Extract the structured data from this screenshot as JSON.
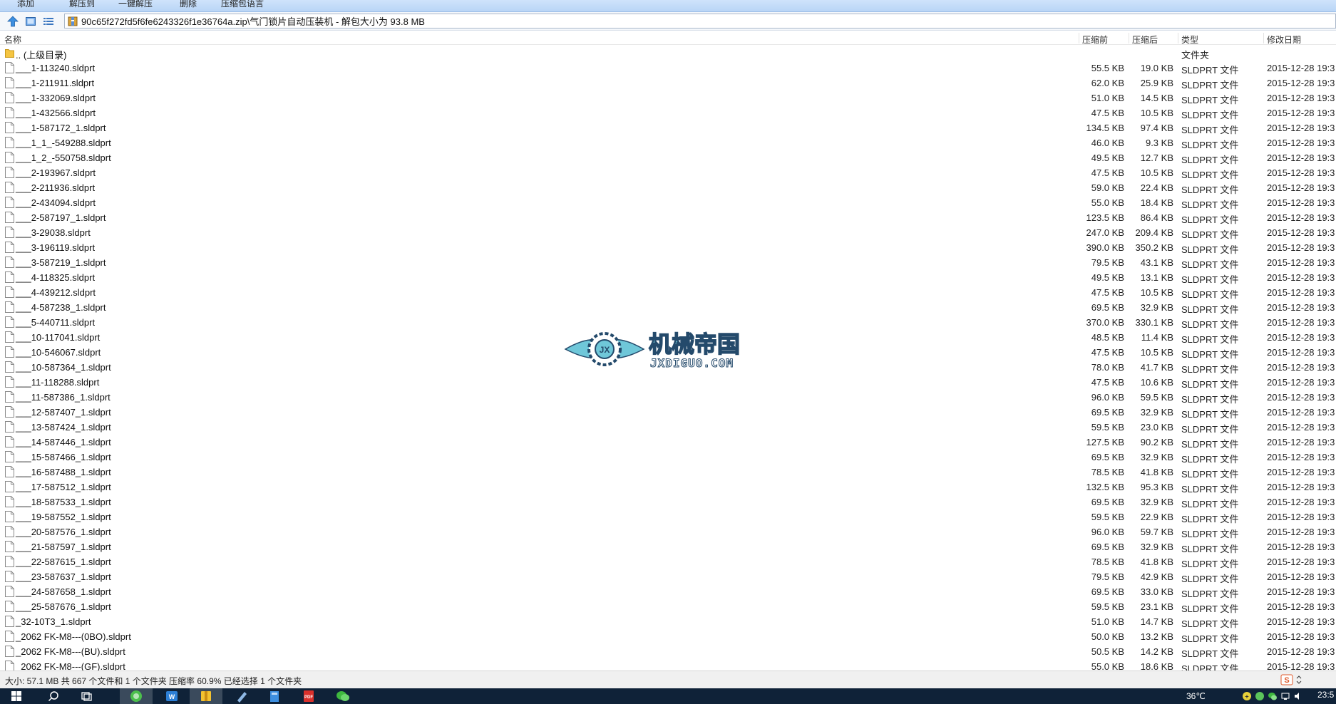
{
  "toolbar": {
    "buttons": [
      "添加",
      "解压到",
      "一键解压",
      "删除",
      "压缩包语言"
    ]
  },
  "address": {
    "path": "90c65f272fd5f6fe6243326f1e36764a.zip\\气门锁片自动压装机 - 解包大小为 93.8 MB"
  },
  "columns": {
    "name": "名称",
    "compressed": "压缩前",
    "packed": "压缩后",
    "type": "类型",
    "modified": "修改日期"
  },
  "parent_dir": {
    "name": ".. (上级目录)",
    "type": "文件夹"
  },
  "files": [
    {
      "name": "___1-113240.sldprt",
      "before": "55.5 KB",
      "after": "19.0 KB",
      "type": "SLDPRT 文件",
      "date": "2015-12-28 19:3"
    },
    {
      "name": "___1-211911.sldprt",
      "before": "62.0 KB",
      "after": "25.9 KB",
      "type": "SLDPRT 文件",
      "date": "2015-12-28 19:3"
    },
    {
      "name": "___1-332069.sldprt",
      "before": "51.0 KB",
      "after": "14.5 KB",
      "type": "SLDPRT 文件",
      "date": "2015-12-28 19:3"
    },
    {
      "name": "___1-432566.sldprt",
      "before": "47.5 KB",
      "after": "10.5 KB",
      "type": "SLDPRT 文件",
      "date": "2015-12-28 19:3"
    },
    {
      "name": "___1-587172_1.sldprt",
      "before": "134.5 KB",
      "after": "97.4 KB",
      "type": "SLDPRT 文件",
      "date": "2015-12-28 19:3"
    },
    {
      "name": "___1_1_-549288.sldprt",
      "before": "46.0 KB",
      "after": "9.3 KB",
      "type": "SLDPRT 文件",
      "date": "2015-12-28 19:3"
    },
    {
      "name": "___1_2_-550758.sldprt",
      "before": "49.5 KB",
      "after": "12.7 KB",
      "type": "SLDPRT 文件",
      "date": "2015-12-28 19:3"
    },
    {
      "name": "___2-193967.sldprt",
      "before": "47.5 KB",
      "after": "10.5 KB",
      "type": "SLDPRT 文件",
      "date": "2015-12-28 19:3"
    },
    {
      "name": "___2-211936.sldprt",
      "before": "59.0 KB",
      "after": "22.4 KB",
      "type": "SLDPRT 文件",
      "date": "2015-12-28 19:3"
    },
    {
      "name": "___2-434094.sldprt",
      "before": "55.0 KB",
      "after": "18.4 KB",
      "type": "SLDPRT 文件",
      "date": "2015-12-28 19:3"
    },
    {
      "name": "___2-587197_1.sldprt",
      "before": "123.5 KB",
      "after": "86.4 KB",
      "type": "SLDPRT 文件",
      "date": "2015-12-28 19:3"
    },
    {
      "name": "___3-29038.sldprt",
      "before": "247.0 KB",
      "after": "209.4 KB",
      "type": "SLDPRT 文件",
      "date": "2015-12-28 19:3"
    },
    {
      "name": "___3-196119.sldprt",
      "before": "390.0 KB",
      "after": "350.2 KB",
      "type": "SLDPRT 文件",
      "date": "2015-12-28 19:3"
    },
    {
      "name": "___3-587219_1.sldprt",
      "before": "79.5 KB",
      "after": "43.1 KB",
      "type": "SLDPRT 文件",
      "date": "2015-12-28 19:3"
    },
    {
      "name": "___4-118325.sldprt",
      "before": "49.5 KB",
      "after": "13.1 KB",
      "type": "SLDPRT 文件",
      "date": "2015-12-28 19:3"
    },
    {
      "name": "___4-439212.sldprt",
      "before": "47.5 KB",
      "after": "10.5 KB",
      "type": "SLDPRT 文件",
      "date": "2015-12-28 19:3"
    },
    {
      "name": "___4-587238_1.sldprt",
      "before": "69.5 KB",
      "after": "32.9 KB",
      "type": "SLDPRT 文件",
      "date": "2015-12-28 19:3"
    },
    {
      "name": "___5-440711.sldprt",
      "before": "370.0 KB",
      "after": "330.1 KB",
      "type": "SLDPRT 文件",
      "date": "2015-12-28 19:3"
    },
    {
      "name": "___10-117041.sldprt",
      "before": "48.5 KB",
      "after": "11.4 KB",
      "type": "SLDPRT 文件",
      "date": "2015-12-28 19:3"
    },
    {
      "name": "___10-546067.sldprt",
      "before": "47.5 KB",
      "after": "10.5 KB",
      "type": "SLDPRT 文件",
      "date": "2015-12-28 19:3"
    },
    {
      "name": "___10-587364_1.sldprt",
      "before": "78.0 KB",
      "after": "41.7 KB",
      "type": "SLDPRT 文件",
      "date": "2015-12-28 19:3"
    },
    {
      "name": "___11-118288.sldprt",
      "before": "47.5 KB",
      "after": "10.6 KB",
      "type": "SLDPRT 文件",
      "date": "2015-12-28 19:3"
    },
    {
      "name": "___11-587386_1.sldprt",
      "before": "96.0 KB",
      "after": "59.5 KB",
      "type": "SLDPRT 文件",
      "date": "2015-12-28 19:3"
    },
    {
      "name": "___12-587407_1.sldprt",
      "before": "69.5 KB",
      "after": "32.9 KB",
      "type": "SLDPRT 文件",
      "date": "2015-12-28 19:3"
    },
    {
      "name": "___13-587424_1.sldprt",
      "before": "59.5 KB",
      "after": "23.0 KB",
      "type": "SLDPRT 文件",
      "date": "2015-12-28 19:3"
    },
    {
      "name": "___14-587446_1.sldprt",
      "before": "127.5 KB",
      "after": "90.2 KB",
      "type": "SLDPRT 文件",
      "date": "2015-12-28 19:3"
    },
    {
      "name": "___15-587466_1.sldprt",
      "before": "69.5 KB",
      "after": "32.9 KB",
      "type": "SLDPRT 文件",
      "date": "2015-12-28 19:3"
    },
    {
      "name": "___16-587488_1.sldprt",
      "before": "78.5 KB",
      "after": "41.8 KB",
      "type": "SLDPRT 文件",
      "date": "2015-12-28 19:3"
    },
    {
      "name": "___17-587512_1.sldprt",
      "before": "132.5 KB",
      "after": "95.3 KB",
      "type": "SLDPRT 文件",
      "date": "2015-12-28 19:3"
    },
    {
      "name": "___18-587533_1.sldprt",
      "before": "69.5 KB",
      "after": "32.9 KB",
      "type": "SLDPRT 文件",
      "date": "2015-12-28 19:3"
    },
    {
      "name": "___19-587552_1.sldprt",
      "before": "59.5 KB",
      "after": "22.9 KB",
      "type": "SLDPRT 文件",
      "date": "2015-12-28 19:3"
    },
    {
      "name": "___20-587576_1.sldprt",
      "before": "96.0 KB",
      "after": "59.7 KB",
      "type": "SLDPRT 文件",
      "date": "2015-12-28 19:3"
    },
    {
      "name": "___21-587597_1.sldprt",
      "before": "69.5 KB",
      "after": "32.9 KB",
      "type": "SLDPRT 文件",
      "date": "2015-12-28 19:3"
    },
    {
      "name": "___22-587615_1.sldprt",
      "before": "78.5 KB",
      "after": "41.8 KB",
      "type": "SLDPRT 文件",
      "date": "2015-12-28 19:3"
    },
    {
      "name": "___23-587637_1.sldprt",
      "before": "79.5 KB",
      "after": "42.9 KB",
      "type": "SLDPRT 文件",
      "date": "2015-12-28 19:3"
    },
    {
      "name": "___24-587658_1.sldprt",
      "before": "69.5 KB",
      "after": "33.0 KB",
      "type": "SLDPRT 文件",
      "date": "2015-12-28 19:3"
    },
    {
      "name": "___25-587676_1.sldprt",
      "before": "59.5 KB",
      "after": "23.1 KB",
      "type": "SLDPRT 文件",
      "date": "2015-12-28 19:3"
    },
    {
      "name": "_32-10T3_1.sldprt",
      "before": "51.0 KB",
      "after": "14.7 KB",
      "type": "SLDPRT 文件",
      "date": "2015-12-28 19:3"
    },
    {
      "name": "_2062 FK-M8---(0BO).sldprt",
      "before": "50.0 KB",
      "after": "13.2 KB",
      "type": "SLDPRT 文件",
      "date": "2015-12-28 19:3"
    },
    {
      "name": "_2062 FK-M8---(BU).sldprt",
      "before": "50.5 KB",
      "after": "14.2 KB",
      "type": "SLDPRT 文件",
      "date": "2015-12-28 19:3"
    },
    {
      "name": "_2062 FK-M8---(GF).sldprt",
      "before": "55.0 KB",
      "after": "18.6 KB",
      "type": "SLDPRT 文件",
      "date": "2015-12-28 19:3"
    }
  ],
  "watermark": {
    "title": "机械帝国",
    "subtitle": "JXDIGUO.COM"
  },
  "status": {
    "text": "大小: 57.1 MB 共 667 个文件和 1 个文件夹 压缩率 60.9% 已经选择 1 个文件夹"
  },
  "taskbar": {
    "temperature": "36℃",
    "clock": "23:5"
  },
  "colors": {
    "folder": "#f5c542",
    "taskbar": "#0f2238",
    "watermark_blue": "#2d6aa3",
    "watermark_teal": "#6fc7d9"
  }
}
